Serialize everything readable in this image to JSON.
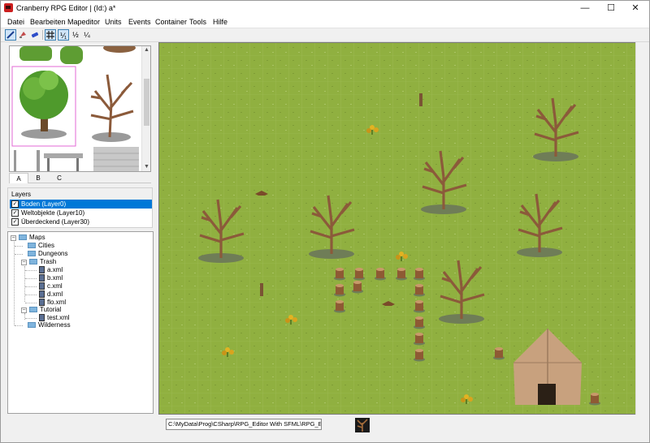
{
  "window": {
    "title": "Cranberry RPG Editor | (Id:) a*",
    "controls": {
      "minimize": "—",
      "maximize": "☐",
      "close": "✕"
    }
  },
  "menu": [
    "Datei",
    "Bearbeiten",
    "Mapeditor",
    "Units",
    "Events",
    "Container",
    "Tools",
    "Hilfe"
  ],
  "toolbar": {
    "tools": [
      "pencil-icon",
      "fill-icon",
      "eraser-icon",
      "grid-icon",
      "scale-1-1-icon",
      "scale-1-2-icon",
      "scale-1-4-icon"
    ],
    "labels": {
      "scale_1_1": "⅟₁",
      "scale_1_2": "½",
      "scale_1_4": "¼"
    }
  },
  "tileset": {
    "tabs": [
      "A",
      "B",
      "C"
    ],
    "active_tab": "A"
  },
  "layers": {
    "title": "Layers",
    "items": [
      {
        "label": "Boden (Layer0)",
        "checked": true,
        "selected": true
      },
      {
        "label": "Weltobjekte (Layer10)",
        "checked": true,
        "selected": false
      },
      {
        "label": "Überdeckend (Layer30)",
        "checked": true,
        "selected": false
      }
    ]
  },
  "tree": {
    "root": "Maps",
    "items": [
      "Cities",
      "Dungeons",
      "Trash",
      "a.xml",
      "b.xml",
      "c.xml",
      "d.xml",
      "flo.xml",
      "Tutorial",
      "test.xml",
      "Wilderness"
    ]
  },
  "status": {
    "path": "C:\\MyData\\Prog\\CSharp\\RPG_Editor With SFML\\RPG_Editor\\b"
  },
  "colors": {
    "grass": "#90b040",
    "selection": "#0078d7",
    "tree_crown": "#4f9a2c",
    "bare_tree": "#8b5a3a"
  }
}
